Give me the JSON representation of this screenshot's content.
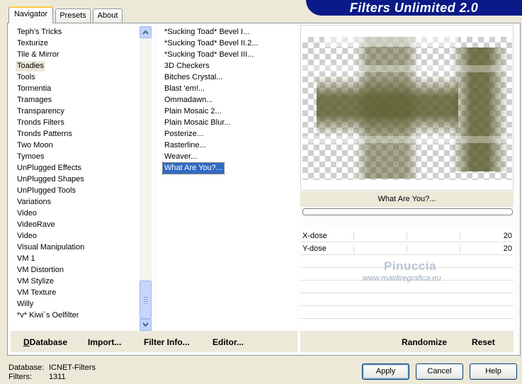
{
  "tabs": [
    {
      "label": "Navigator",
      "active": true
    },
    {
      "label": "Presets",
      "active": false
    },
    {
      "label": "About",
      "active": false
    }
  ],
  "title": "Filters Unlimited 2.0",
  "categories": {
    "items": [
      "Teph's Tricks",
      "Texturize",
      "Tile & Mirror",
      "Toadies",
      "Tools",
      "Tormentia",
      "Tramages",
      "Transparency",
      "Tronds Filters",
      "Tronds Patterns",
      "Two Moon",
      "Tymoes",
      "UnPlugged Effects",
      "UnPlugged Shapes",
      "UnPlugged Tools",
      "Variations",
      "Video",
      "VideoRave",
      "Video",
      "Visual Manipulation",
      "VM 1",
      "VM Distortion",
      "VM Stylize",
      "VM Texture",
      "Willy",
      "*v* Kiwi`s Oelfilter"
    ],
    "selected": "Toadies"
  },
  "filters": {
    "items": [
      "*Sucking Toad*  Bevel I...",
      "*Sucking Toad*  Bevel II.2...",
      "*Sucking Toad*  Bevel III...",
      "3D Checkers",
      "Bitches Crystal...",
      "Blast 'em!...",
      "Ommadawn...",
      "Plain Mosaic 2...",
      "Plain Mosaic Blur...",
      "Posterize...",
      "Rasterline...",
      "Weaver...",
      "What Are You?..."
    ],
    "selected": "What Are You?..."
  },
  "toolbar": {
    "database": "Database",
    "import": "Import...",
    "filter_info": "Filter Info...",
    "editor": "Editor..."
  },
  "preview": {
    "filter_name": "What Are You?...",
    "progress": 0,
    "colors": {
      "olive": "#5e5e30",
      "checker": "#cfcfcf"
    }
  },
  "params": [
    {
      "label": "X-dose",
      "value": "20"
    },
    {
      "label": "Y-dose",
      "value": "20"
    }
  ],
  "watermark": {
    "name": "Pinuccia",
    "url": "www.maidiregrafica.eu"
  },
  "right_actions": {
    "randomize": "Randomize",
    "reset": "Reset"
  },
  "info": {
    "database_label": "Database:",
    "database_value": "ICNET-Filters",
    "filters_label": "Filters:",
    "filters_value": "1311"
  },
  "buttons": {
    "apply": "Apply",
    "cancel": "Cancel",
    "help": "Help"
  },
  "icons": {
    "scroll_up": "chevron-up-icon",
    "scroll_down": "chevron-down-icon"
  }
}
